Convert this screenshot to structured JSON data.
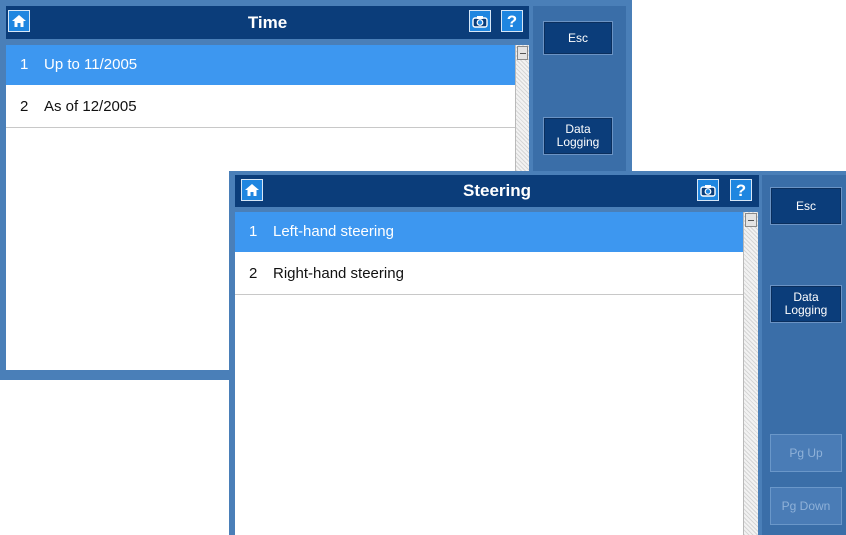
{
  "windows": [
    {
      "title": "Time",
      "items": [
        {
          "num": "1",
          "label": "Up to 11/2005",
          "selected": true
        },
        {
          "num": "2",
          "label": "As of 12/2005",
          "selected": false
        }
      ],
      "help": "?",
      "side_buttons": {
        "esc": "Esc",
        "data_logging": "Data\nLogging"
      }
    },
    {
      "title": "Steering",
      "items": [
        {
          "num": "1",
          "label": "Left-hand steering",
          "selected": true
        },
        {
          "num": "2",
          "label": "Right-hand steering",
          "selected": false
        }
      ],
      "help": "?",
      "side_buttons": {
        "esc": "Esc",
        "data_logging": "Data\nLogging",
        "pg_up": "Pg Up",
        "pg_down": "Pg Down"
      }
    }
  ],
  "colors": {
    "titlebar": "#0b3d7a",
    "selected_row": "#3d97f0",
    "side_panel": "#3a6ea8",
    "button": "#0b3d7a",
    "disabled_button": "#4a7cb6"
  },
  "icons": {
    "home": "home-icon",
    "camera": "camera-icon",
    "help": "help-icon"
  }
}
